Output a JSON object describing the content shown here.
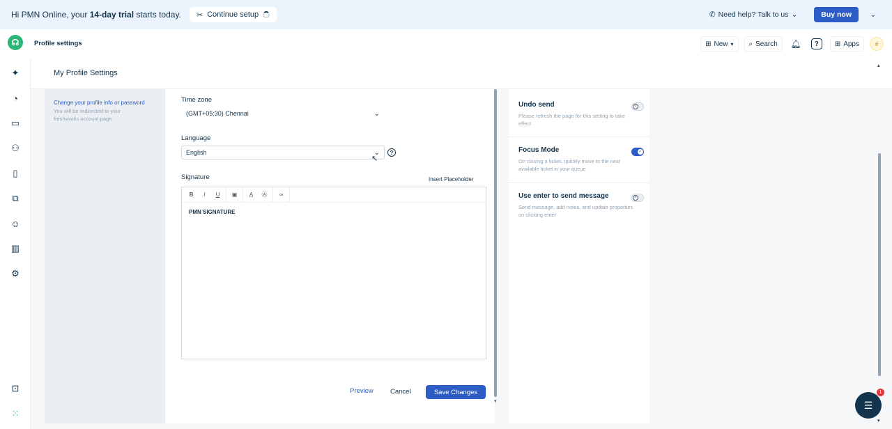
{
  "banner": {
    "greeting_prefix": "Hi PMN Online, your ",
    "greeting_bold": "14-day trial",
    "greeting_suffix": " starts today.",
    "continue_label": "Continue setup",
    "help_label": "Need help? Talk to us",
    "buy_label": "Buy now"
  },
  "topbar": {
    "page": "Profile settings",
    "new_label": "New",
    "search_label": "Search",
    "apps_label": "Apps",
    "avatar_initial": "#"
  },
  "sidebar": {
    "items": [
      "sparkle-icon",
      "dashboard-icon",
      "tickets-icon",
      "contacts-icon",
      "solutions-icon",
      "inbox-icon",
      "bot-icon",
      "reports-icon",
      "settings-icon"
    ]
  },
  "header": {
    "title": "My Profile Settings"
  },
  "left_panel": {
    "link": "Change your profile info or password",
    "desc": "You will be redirected to your freshworks account page"
  },
  "form": {
    "timezone_label": "Time zone",
    "timezone_value": "(GMT+05:30) Chennai",
    "language_label": "Language",
    "language_value": "English",
    "signature_label": "Signature",
    "insert_placeholder": "Insert Placeholder",
    "toolbar": [
      "B",
      "I",
      "U"
    ],
    "signature_text": "PMN SIGNATURE",
    "preview_label": "Preview",
    "cancel_label": "Cancel",
    "save_label": "Save Changes"
  },
  "preferences": [
    {
      "title": "Undo send",
      "desc": "Please refresh the page for this setting to take effect",
      "enabled": false
    },
    {
      "title": "Focus Mode",
      "desc": "On closing a ticket, quickly move to the next available ticket in your queue",
      "enabled": true
    },
    {
      "title": "Use enter to send message",
      "desc": "Send message, add notes, and update properties on clicking enter",
      "enabled": false
    }
  ],
  "chat": {
    "badge": "1"
  },
  "colors": {
    "accent": "#2c5cc5",
    "brand_green": "#2bb673",
    "text": "#12344d"
  }
}
